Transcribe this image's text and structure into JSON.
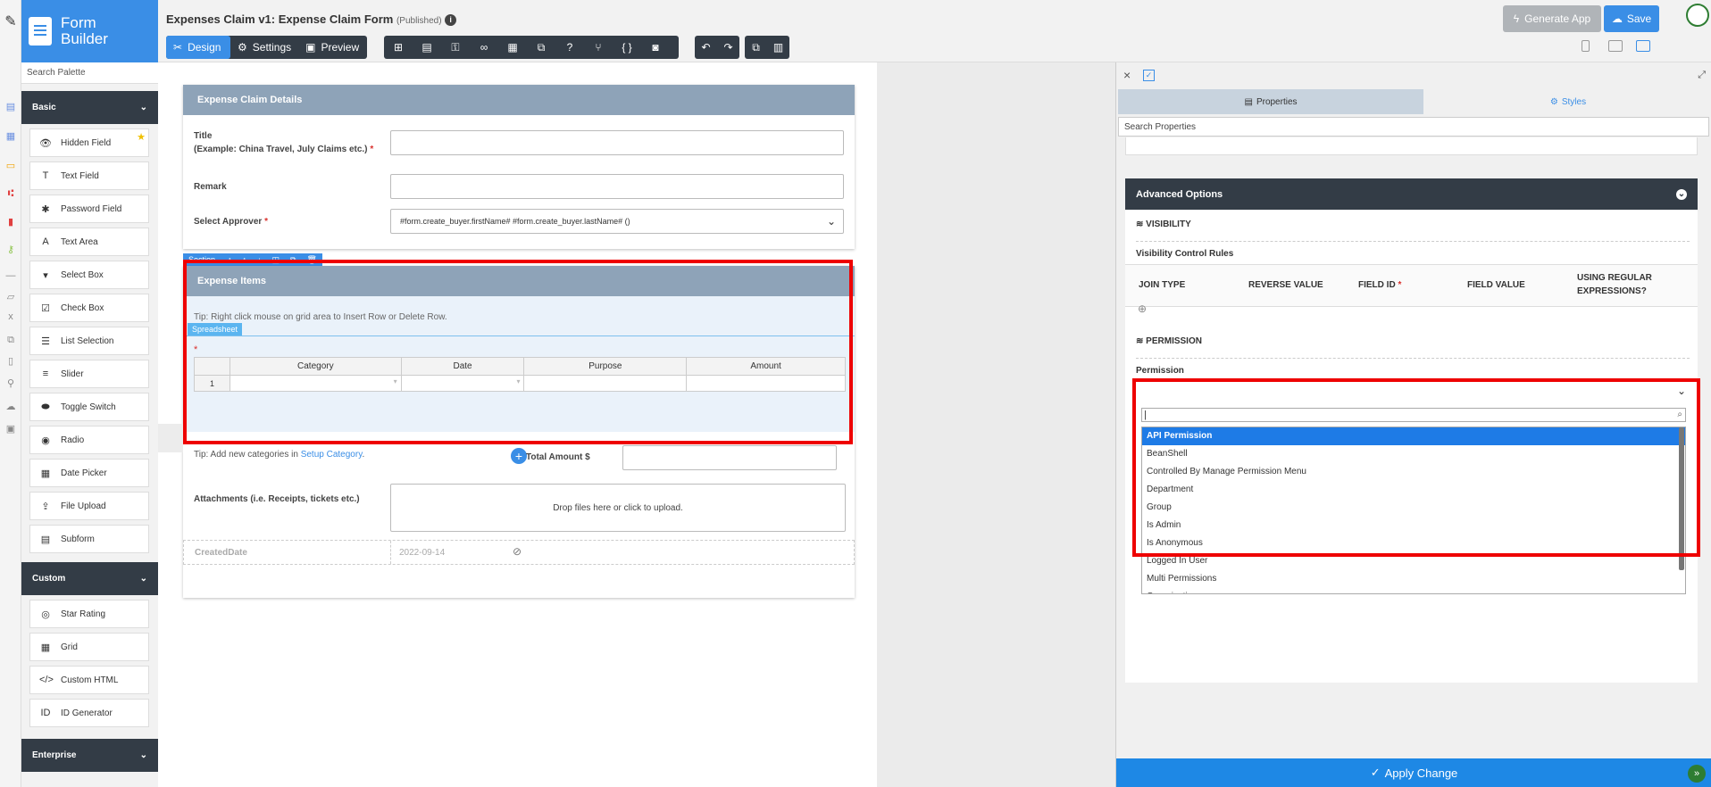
{
  "palette": {
    "brand": "Form\nBuilder",
    "search_placeholder": "Search Palette",
    "basic_label": "Basic",
    "basic_items": [
      {
        "label": "Hidden Field",
        "icon": "eye-slash-icon",
        "glyph": "👁"
      },
      {
        "label": "Text Field",
        "icon": "text-field-icon",
        "glyph": "T"
      },
      {
        "label": "Password Field",
        "icon": "asterisk-icon",
        "glyph": "✱"
      },
      {
        "label": "Text Area",
        "icon": "text-area-icon",
        "glyph": "A"
      },
      {
        "label": "Select Box",
        "icon": "select-box-icon",
        "glyph": "▾"
      },
      {
        "label": "Check Box",
        "icon": "checkbox-icon",
        "glyph": "☑"
      },
      {
        "label": "List Selection",
        "icon": "list-icon",
        "glyph": "☰"
      },
      {
        "label": "Slider",
        "icon": "slider-icon",
        "glyph": "≡"
      },
      {
        "label": "Toggle Switch",
        "icon": "toggle-icon",
        "glyph": "⬬"
      },
      {
        "label": "Radio",
        "icon": "radio-icon",
        "glyph": "◉"
      },
      {
        "label": "Date Picker",
        "icon": "calendar-icon",
        "glyph": "▦"
      },
      {
        "label": "File Upload",
        "icon": "upload-icon",
        "glyph": "⇪"
      },
      {
        "label": "Subform",
        "icon": "subform-icon",
        "glyph": "▤"
      }
    ],
    "custom_label": "Custom",
    "custom_items": [
      {
        "label": "Star Rating",
        "icon": "star-rating-icon",
        "glyph": "◎"
      },
      {
        "label": "Grid",
        "icon": "grid-icon",
        "glyph": "▦"
      },
      {
        "label": "Custom HTML",
        "icon": "code-icon",
        "glyph": "</>"
      },
      {
        "label": "ID Generator",
        "icon": "id-icon",
        "glyph": "ID"
      }
    ],
    "enterprise_label": "Enterprise"
  },
  "toolbar": {
    "title": "Expenses Claim v1: Expense Claim Form",
    "status": "(Published)",
    "design": "Design",
    "settings": "Settings",
    "preview": "Preview",
    "generate_app": "Generate App",
    "save": "Save"
  },
  "form": {
    "details_header": "Expense Claim Details",
    "title_label": "Title",
    "title_hint": "(Example: China Travel, July Claims etc.)",
    "remark_label": "Remark",
    "approver_label": "Select Approver",
    "approver_value": "#form.create_buyer.firstName# #form.create_buyer.lastName# ()",
    "section_label": "Section",
    "items_header": "Expense Items",
    "tip_grid": "Tip: Right click mouse on grid area to Insert Row or Delete Row.",
    "spreadsheet_badge": "Spreadsheet",
    "columns": [
      "Category",
      "Date",
      "Purpose",
      "Amount"
    ],
    "row_number": "1",
    "tip_category_prefix": "Tip: Add new categories in ",
    "tip_category_link": "Setup Category",
    "tip_category_suffix": ".",
    "total_label": "Total Amount $",
    "attachments_label": "Attachments (i.e. Receipts, tickets etc.)",
    "dropzone": "Drop files here or click to upload.",
    "created_label": "CreatedDate",
    "created_value": "2022-09-14"
  },
  "props": {
    "tab_properties": "Properties",
    "tab_styles": "Styles",
    "search_placeholder": "Search Properties",
    "advanced_header": "Advanced Options",
    "visibility_heading": "VISIBILITY",
    "visibility_rules": "Visibility Control Rules",
    "vis_columns": {
      "join": "JOIN TYPE",
      "reverse": "REVERSE VALUE",
      "field_id": "FIELD ID",
      "field_value": "FIELD VALUE",
      "regex": "USING REGULAR EXPRESSIONS?"
    },
    "permission_heading": "PERMISSION",
    "permission_label": "Permission",
    "permission_options": [
      "API Permission",
      "BeanShell",
      "Controlled By Manage Permission Menu",
      "Department",
      "Group",
      "Is Admin",
      "Is Anonymous",
      "Logged In User",
      "Multi Permissions",
      "Organization"
    ],
    "selected_option": "API Permission",
    "apply_change": "Apply Change"
  },
  "colors": {
    "accent": "#3a8ee6",
    "dark": "#333c46",
    "section_header": "#8ea3b8",
    "highlight": "#e00000",
    "selected_option": "#1e7be6"
  }
}
